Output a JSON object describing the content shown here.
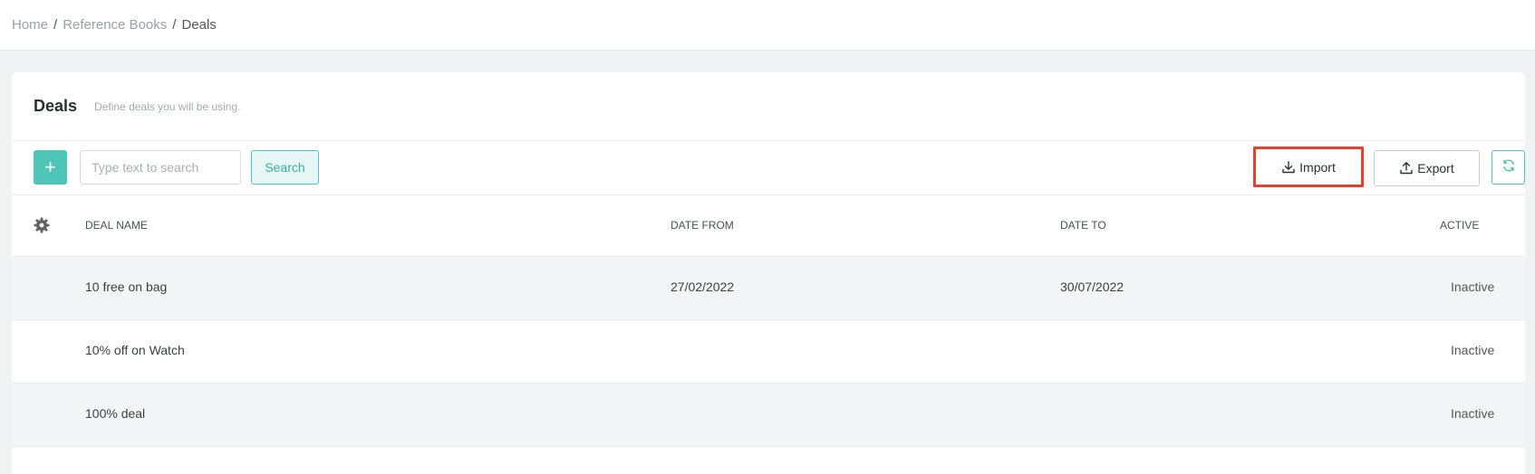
{
  "breadcrumb": {
    "items": [
      "Home",
      "Reference Books",
      "Deals"
    ],
    "separator": "/"
  },
  "header": {
    "title": "Deals",
    "subtitle": "Define deals you will be using."
  },
  "toolbar": {
    "add_label": "+",
    "search_placeholder": "Type text to search",
    "search_value": "",
    "search_label": "Search",
    "import_label": "Import",
    "export_label": "Export",
    "accent_color": "#4ec5b6",
    "highlight_color": "#e8402c"
  },
  "table": {
    "columns": [
      "DEAL NAME",
      "DATE FROM",
      "DATE TO",
      "ACTIVE"
    ],
    "rows": [
      {
        "name": "10 free on bag",
        "date_from": "27/02/2022",
        "date_to": "30/07/2022",
        "active": "Inactive"
      },
      {
        "name": "10% off on Watch",
        "date_from": "",
        "date_to": "",
        "active": "Inactive"
      },
      {
        "name": "100% deal",
        "date_from": "",
        "date_to": "",
        "active": "Inactive"
      }
    ]
  },
  "icons": {
    "settings": "gear-icon",
    "import": "download-icon",
    "export": "upload-icon",
    "refresh": "refresh-icon",
    "add": "plus-icon"
  }
}
